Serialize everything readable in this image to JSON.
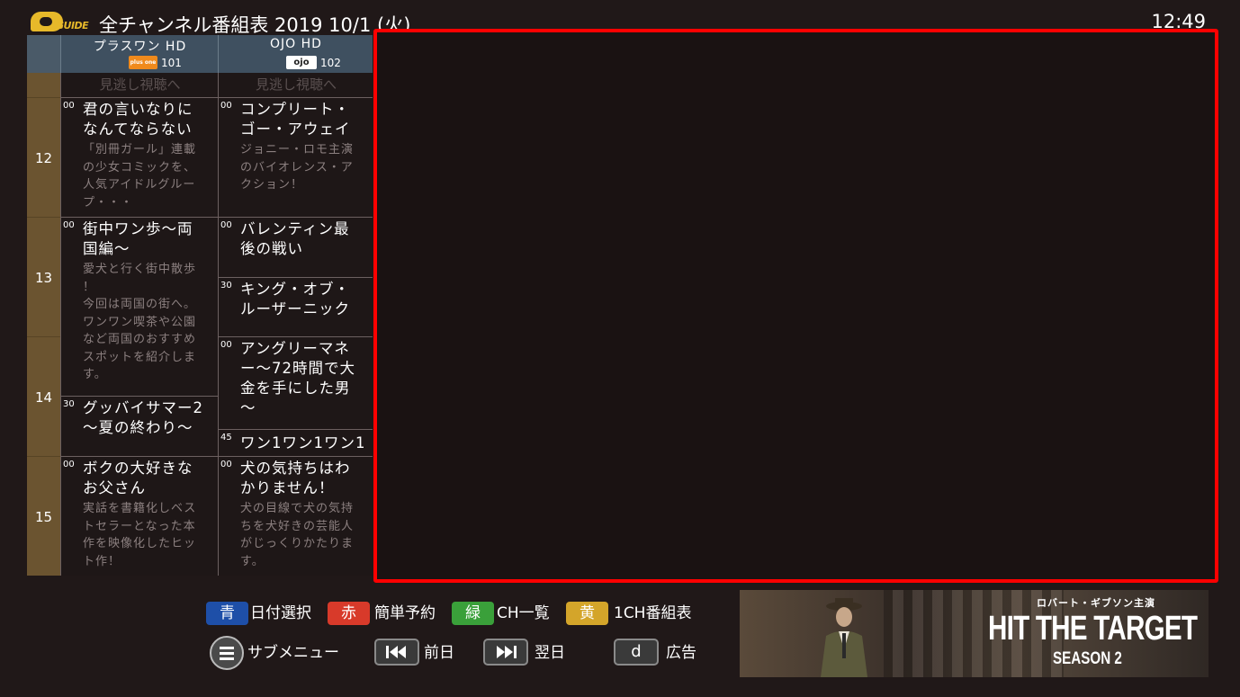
{
  "header": {
    "logo_text": "GUIDE",
    "title": "全チャンネル番組表 2019 10/1 (火)",
    "clock": "12:49"
  },
  "channels": [
    {
      "name": "プラスワン HD",
      "logo": "plus one",
      "number": "101",
      "logo_color": "#f08a1c"
    },
    {
      "name": "OJO HD",
      "logo": "ojo",
      "number": "102",
      "logo_color": "#ffffff"
    }
  ],
  "missed_label": "見逃し視聴へ",
  "hours": [
    "12",
    "13",
    "14",
    "15"
  ],
  "programs": {
    "ch1": [
      {
        "minute": "00",
        "title_lines": [
          "君の言いなりに",
          "なんてならない"
        ],
        "desc_lines": [
          "「別冊ガール」連載",
          "の少女コミックを、",
          "人気アイドルグルー",
          "プ・・・"
        ]
      },
      {
        "minute": "00",
        "title_lines": [
          "街中ワン歩～両",
          "国編～"
        ],
        "desc_lines": [
          "愛犬と行く街中散歩",
          "！",
          "今回は両国の街へ。",
          "ワンワン喫茶や公園",
          "など両国のおすすめ",
          "スポットを紹介しま",
          "す。"
        ]
      },
      {
        "minute": "30",
        "title_lines": [
          "グッバイサマー2",
          "～夏の終わり～"
        ],
        "desc_lines": []
      },
      {
        "minute": "00",
        "title_lines": [
          "ボクの大好きな",
          "お父さん"
        ],
        "desc_lines": [
          "実話を書籍化しベス",
          "トセラーとなった本",
          "作を映像化したヒッ",
          "ト作！"
        ]
      }
    ],
    "ch2": [
      {
        "minute": "00",
        "title_lines": [
          "コンプリート・",
          "ゴー・アウェイ"
        ],
        "desc_lines": [
          "ジョニー・ロモ主演",
          "のバイオレンス・ア",
          "クション！"
        ]
      },
      {
        "minute": "00",
        "title_lines": [
          "バレンティン最",
          "後の戦い"
        ],
        "desc_lines": []
      },
      {
        "minute": "30",
        "title_lines": [
          "キング・オブ・",
          "ルーザーニック"
        ],
        "desc_lines": []
      },
      {
        "minute": "00",
        "title_lines": [
          "アングリーマネ",
          "ー～72時間で大",
          "金を手にした男",
          "～"
        ],
        "desc_lines": []
      },
      {
        "minute": "45",
        "title_lines": [
          "ワン1ワン1ワン1"
        ],
        "desc_lines": []
      },
      {
        "minute": "00",
        "title_lines": [
          "犬の気持ちはわ",
          "かりません！"
        ],
        "desc_lines": [
          "犬の目線で犬の気持",
          "ちを犬好きの芸能人",
          "がじっくりかたりま",
          "す。"
        ]
      }
    ]
  },
  "color_keys": [
    {
      "key": "青",
      "label": "日付選択",
      "color": "#1e4fa8"
    },
    {
      "key": "赤",
      "label": "簡単予約",
      "color": "#d83a2a"
    },
    {
      "key": "緑",
      "label": "CH一覧",
      "color": "#3aa03a"
    },
    {
      "key": "黄",
      "label": "1CH番組表",
      "color": "#d4a52a"
    }
  ],
  "nav": {
    "submenu": "サブメニュー",
    "prev_day": "前日",
    "next_day": "翌日",
    "d_key": "d",
    "ad_label": "広告"
  },
  "ad": {
    "subtitle": "ロバート・ギブソン主演",
    "title": "HIT THE TARGET",
    "season": "SEASON 2"
  }
}
